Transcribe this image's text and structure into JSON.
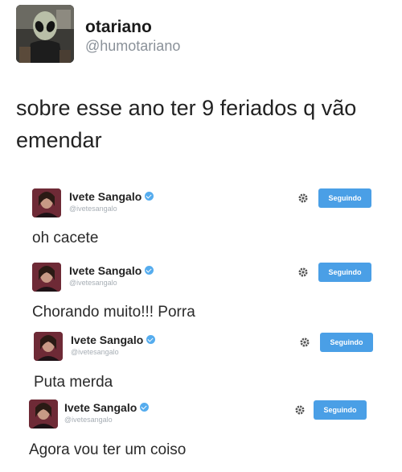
{
  "author": {
    "name": "otariano",
    "handle": "@humotariano",
    "avatar_icon": "alien-avatar"
  },
  "tweet": {
    "text": "sobre esse ano ter 9 feriados q vão emendar"
  },
  "embedded": [
    {
      "name": "Ivete Sangalo",
      "handle": "@ivetesangalo",
      "follow_label": "Seguindo",
      "text": "oh cacete"
    },
    {
      "name": "Ivete Sangalo",
      "handle": "@ivetesangalo",
      "follow_label": "Seguindo",
      "text": "Chorando muito!!! Porra"
    },
    {
      "name": "Ivete Sangalo",
      "handle": "@ivetesangalo",
      "follow_label": "Seguindo",
      "text": "Puta merda"
    },
    {
      "name": "Ivete Sangalo",
      "handle": "@ivetesangalo",
      "follow_label": "Seguindo",
      "text": "Agora vou ter um  coiso"
    }
  ],
  "colors": {
    "follow_button": "#4a9fe6",
    "verified_badge": "#55acee",
    "handle_gray": "#8a9199"
  }
}
